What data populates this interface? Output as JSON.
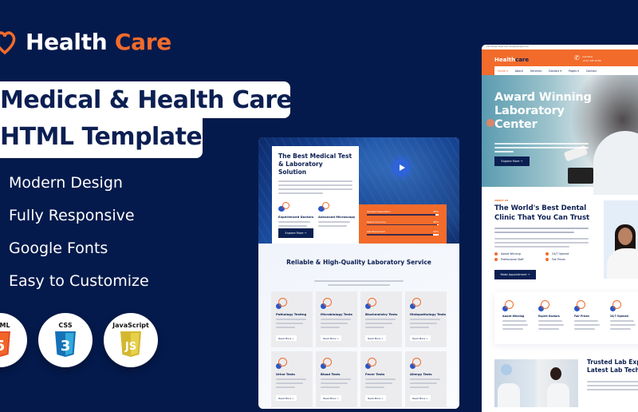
{
  "brand": {
    "name_main": "Health",
    "name_accent": "Care"
  },
  "headline": {
    "line1": "Medical & Health Care",
    "line2": "HTML Template"
  },
  "features": [
    "Modern Design",
    "Fully Responsive",
    "Google Fonts",
    "Easy to Customize"
  ],
  "technologies": [
    {
      "label": "HTML",
      "icon": "html5-icon",
      "color": "#f05a24",
      "glyph": "5"
    },
    {
      "label": "CSS",
      "icon": "css3-icon",
      "color": "#1f6fe5",
      "glyph": "3"
    },
    {
      "label": "JavaScript",
      "icon": "js-icon",
      "color": "#d4b52f",
      "glyph": "JS"
    }
  ],
  "colors": {
    "accent": "#f26b2b",
    "navy": "#0b1f52",
    "background": "#041a4c"
  },
  "preview_lab": {
    "hero_title": "The Best Medical Test & Laboratory Solution",
    "features": [
      {
        "title": "Experienced Doctors",
        "icon": "doctor-icon"
      },
      {
        "title": "Advanced Microscopy",
        "icon": "microscope-icon"
      }
    ],
    "explore_button": "Explore More →",
    "play_icon": "play-icon",
    "progress": [
      {
        "label": "Sample Preparation",
        "value": 95
      },
      {
        "label": "Result Accuracy",
        "value": 98
      },
      {
        "label": "Lab Equipment",
        "value": 92
      }
    ],
    "services_title": "Reliable & High-Quality Laboratory Service",
    "services": [
      {
        "title": "Pathology Testing",
        "icon": "heart-pulse-icon"
      },
      {
        "title": "Microbiology Tests",
        "icon": "lungs-icon"
      },
      {
        "title": "Biochemistry Tests",
        "icon": "virus-icon"
      },
      {
        "title": "Histopathology Tests",
        "icon": "pill-icon"
      },
      {
        "title": "Urine Tests",
        "icon": "capsule-icon"
      },
      {
        "title": "Blood Tests",
        "icon": "blood-bag-icon"
      },
      {
        "title": "Fever Tests",
        "icon": "clipboard-icon"
      },
      {
        "title": "Allergy Tests",
        "icon": "report-icon"
      }
    ],
    "read_more": "Read More >"
  },
  "preview_home": {
    "topbar": "123 Street, New York   info@example.com",
    "brand_main": "Health",
    "brand_accent": "care",
    "call_label": "Call Now",
    "call_number": "+012 345 6789",
    "nav": [
      "Home ▾",
      "About",
      "Services",
      "Doctors ▾",
      "Pages ▾",
      "Contact"
    ],
    "hero_title": "Award Winning Laboratory Center",
    "hero_button": "Explore More →",
    "about_tag": "ABOUT US",
    "about_title_line1": "The World's Best Dental",
    "about_title_line2": "Clinic That You Can Trust",
    "about_checks": [
      "Award Winning",
      "24/7 Opened",
      "Professional Staff",
      "Fair Prices"
    ],
    "about_button": "Make Appointment →",
    "feature_cards": [
      {
        "title": "Award Winning",
        "icon": "award-icon"
      },
      {
        "title": "Expert Doctors",
        "icon": "team-icon"
      },
      {
        "title": "Fair Prices",
        "icon": "price-icon"
      },
      {
        "title": "24/7 Opened",
        "icon": "clock-icon"
      }
    ],
    "trusted_line1": "Trusted Lab Experts and",
    "trusted_line2": "Latest Lab Technology"
  }
}
